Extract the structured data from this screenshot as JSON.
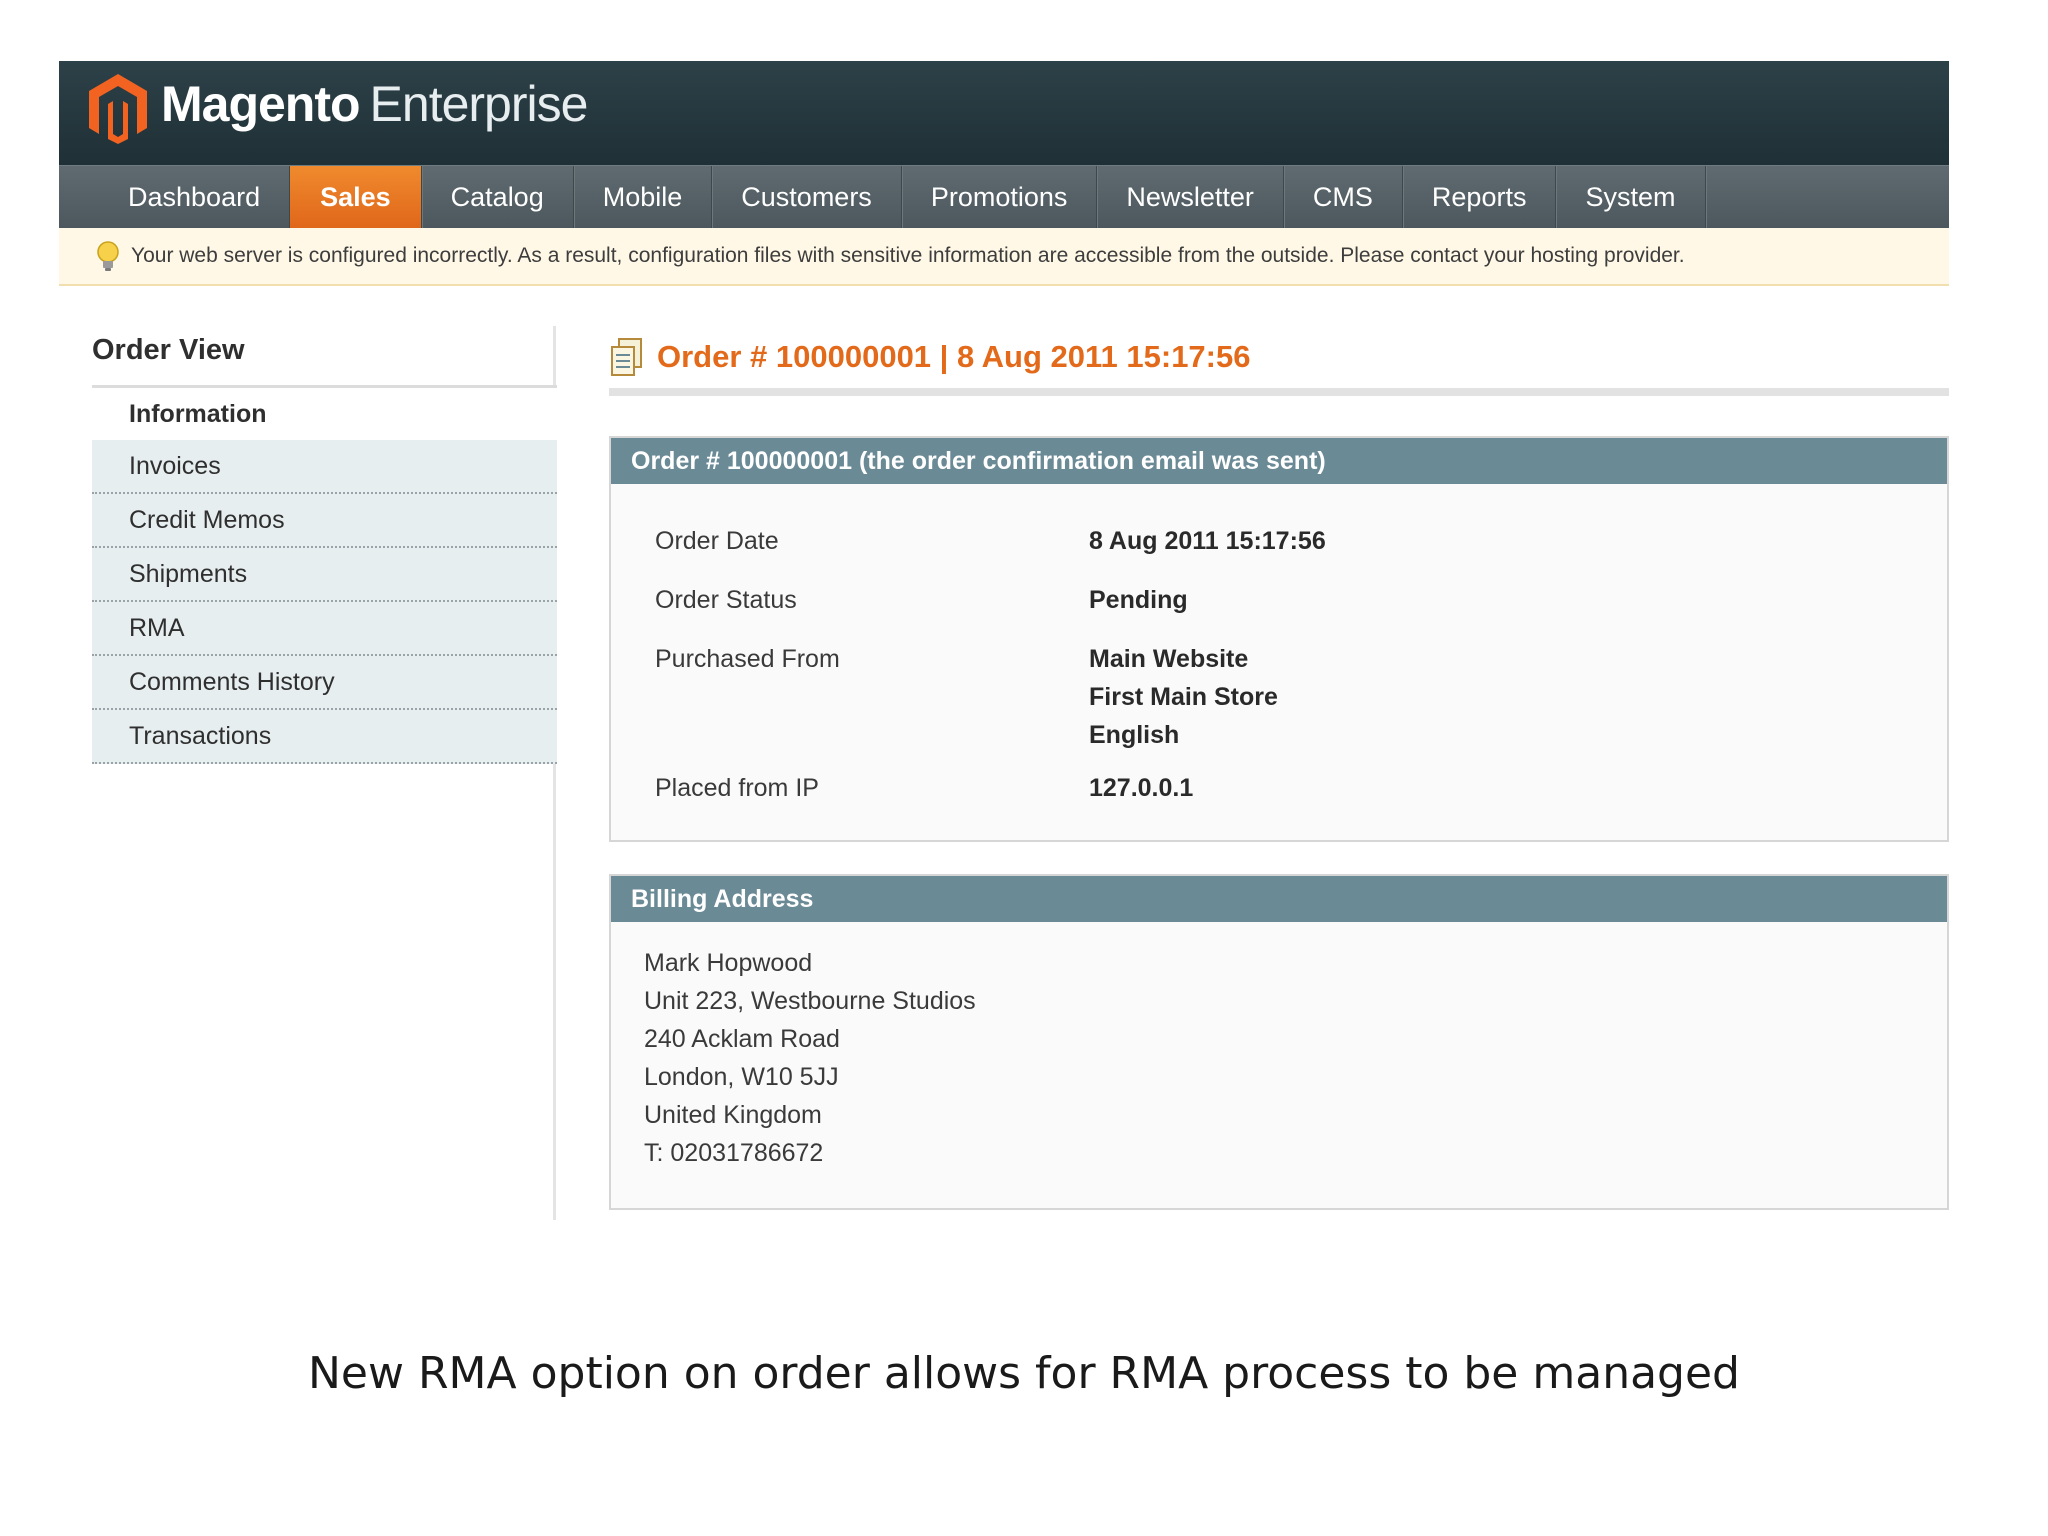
{
  "header": {
    "brand_bold": "Magento",
    "brand_light": "Enterprise"
  },
  "nav": {
    "items": [
      {
        "label": "Dashboard",
        "active": false
      },
      {
        "label": "Sales",
        "active": true
      },
      {
        "label": "Catalog",
        "active": false
      },
      {
        "label": "Mobile",
        "active": false
      },
      {
        "label": "Customers",
        "active": false
      },
      {
        "label": "Promotions",
        "active": false
      },
      {
        "label": "Newsletter",
        "active": false
      },
      {
        "label": "CMS",
        "active": false
      },
      {
        "label": "Reports",
        "active": false
      },
      {
        "label": "System",
        "active": false
      }
    ]
  },
  "notice": {
    "text": "Your web server is configured incorrectly. As a result, configuration files with sensitive information are accessible from the outside. Please contact your hosting provider.",
    "icon": "lightbulb-icon"
  },
  "sidebar": {
    "title": "Order View",
    "items": [
      {
        "label": "Information",
        "active": true
      },
      {
        "label": "Invoices",
        "active": false
      },
      {
        "label": "Credit Memos",
        "active": false
      },
      {
        "label": "Shipments",
        "active": false
      },
      {
        "label": "RMA",
        "active": false
      },
      {
        "label": "Comments History",
        "active": false
      },
      {
        "label": "Transactions",
        "active": false
      }
    ]
  },
  "main": {
    "page_title": "Order # 100000001 | 8 Aug 2011 15:17:56",
    "order_box": {
      "title": "Order # 100000001 (the order confirmation email was sent)",
      "rows": [
        {
          "label": "Order Date",
          "value": "8 Aug 2011 15:17:56"
        },
        {
          "label": "Order Status",
          "value": "Pending"
        },
        {
          "label": "Purchased From",
          "values": [
            "Main Website",
            "First Main Store",
            "English"
          ]
        },
        {
          "label": "Placed from IP",
          "value": "127.0.0.1"
        }
      ]
    },
    "billing_box": {
      "title": "Billing Address",
      "lines": [
        "Mark Hopwood",
        "Unit 223, Westbourne Studios",
        "240 Acklam Road",
        "London, W10 5JJ",
        "United Kingdom",
        "T: 02031786672"
      ]
    }
  },
  "caption": "New RMA option on order allows for RMA process to be managed",
  "colors": {
    "accent_orange": "#e26a1a",
    "box_header": "#6a8a96",
    "header_dark": "#243840"
  }
}
